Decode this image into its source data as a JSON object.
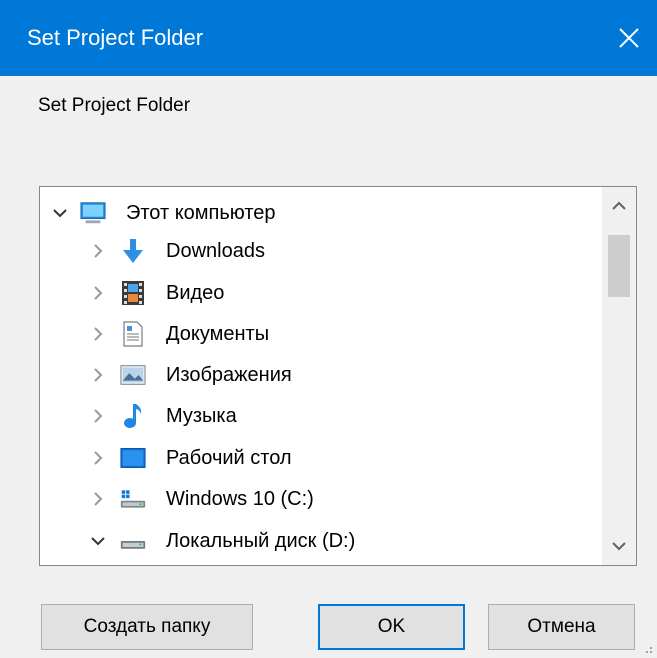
{
  "window": {
    "title": "Set Project Folder"
  },
  "dialog": {
    "prompt": "Set Project Folder"
  },
  "tree": {
    "items": [
      {
        "label": "Этот компьютер",
        "expanded": true,
        "icon": "computer-icon"
      },
      {
        "label": "Downloads",
        "expanded": false,
        "icon": "downloads-icon"
      },
      {
        "label": "Видео",
        "expanded": false,
        "icon": "video-icon"
      },
      {
        "label": "Документы",
        "expanded": false,
        "icon": "documents-icon"
      },
      {
        "label": "Изображения",
        "expanded": false,
        "icon": "pictures-icon"
      },
      {
        "label": "Музыка",
        "expanded": false,
        "icon": "music-icon"
      },
      {
        "label": "Рабочий стол",
        "expanded": false,
        "icon": "desktop-icon"
      },
      {
        "label": "Windows 10 (C:)",
        "expanded": false,
        "icon": "system-drive-icon"
      },
      {
        "label": "Локальный диск (D:)",
        "expanded": true,
        "icon": "drive-icon"
      }
    ]
  },
  "buttons": {
    "new_folder": "Создать папку",
    "ok": "OK",
    "cancel": "Отмена"
  },
  "colors": {
    "titlebar": "#0078d7",
    "accent": "#0078d7"
  }
}
